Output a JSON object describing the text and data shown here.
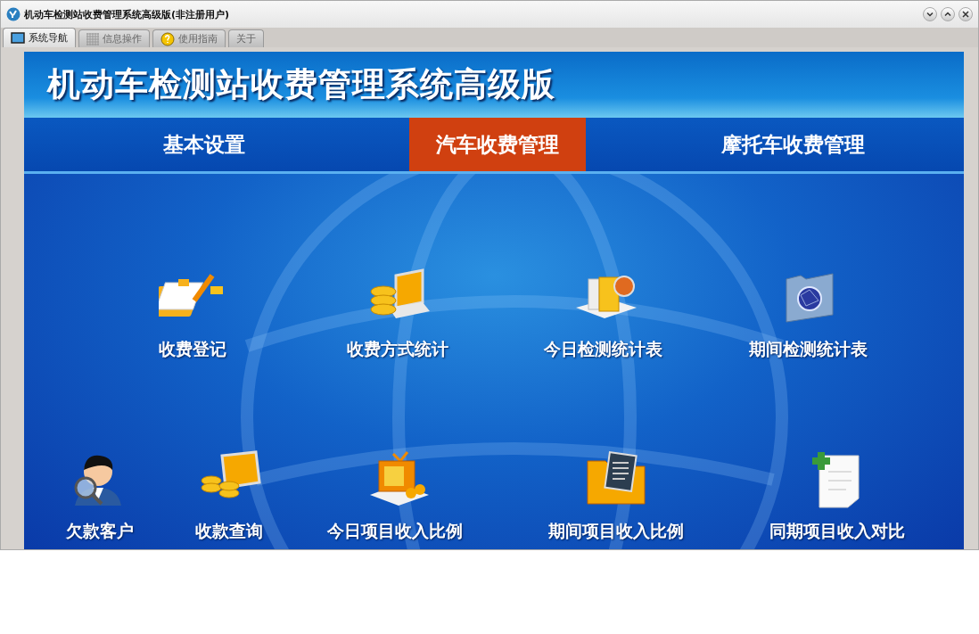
{
  "window": {
    "title": "机动车检测站收费管理系统高级版(非注册用户)"
  },
  "tabs": [
    {
      "label": "系统导航",
      "selected": true
    },
    {
      "label": "信息操作",
      "selected": false
    },
    {
      "label": "使用指南",
      "selected": false
    },
    {
      "label": "关于",
      "selected": false
    }
  ],
  "banner": {
    "title": "机动车检测站收费管理系统高级版"
  },
  "nav": [
    {
      "label": "基本设置",
      "selected": false
    },
    {
      "label": "汽车收费管理",
      "selected": true
    },
    {
      "label": "摩托车收费管理",
      "selected": false
    }
  ],
  "rows": [
    {
      "items": [
        {
          "label": "收费登记"
        },
        {
          "label": "收费方式统计"
        },
        {
          "label": "今日检测统计表"
        },
        {
          "label": "期间检测统计表"
        }
      ]
    },
    {
      "items": [
        {
          "label": "欠款客户"
        },
        {
          "label": "收款查询"
        },
        {
          "label": "今日项目收入比例"
        },
        {
          "label": "期间项目收入比例"
        },
        {
          "label": "同期项目收入对比"
        }
      ]
    }
  ]
}
